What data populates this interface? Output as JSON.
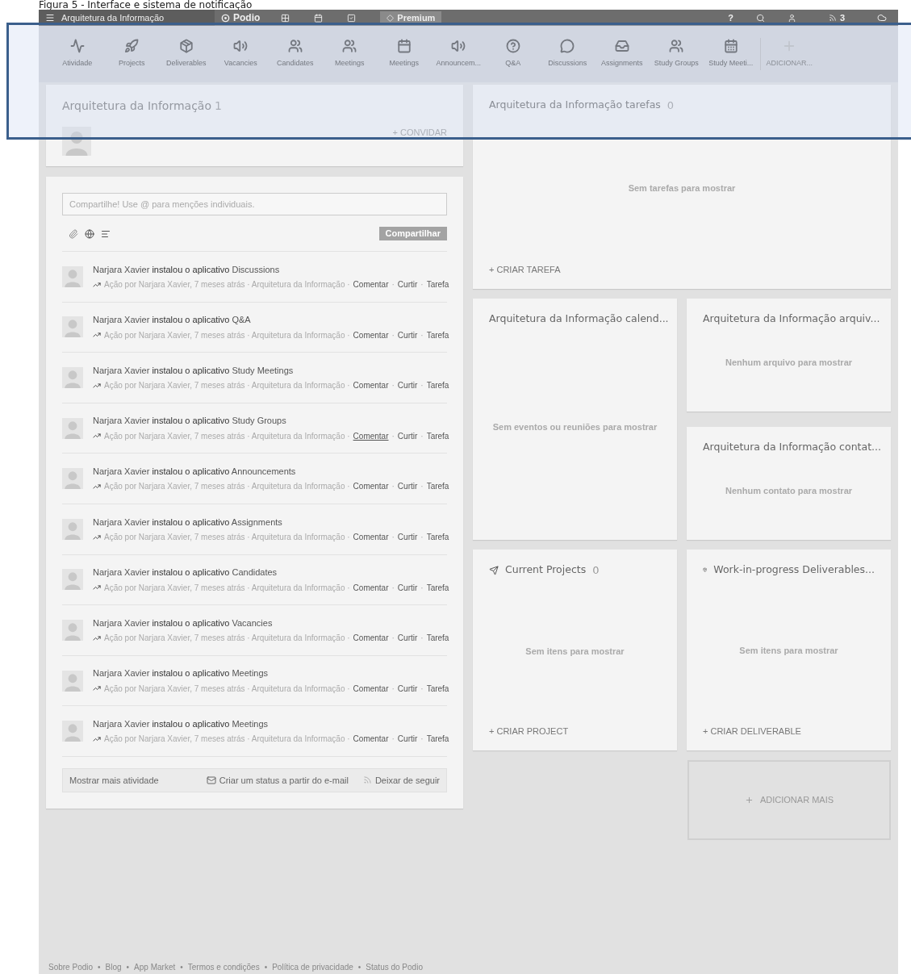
{
  "caption": "Figura 5 - Interface e sistema de notificação",
  "topbar": {
    "workspace": "Arquitetura da Informação",
    "logo": "Podio",
    "premium": "Premium",
    "help": "?",
    "notifications": "3"
  },
  "apps": [
    {
      "label": "Atividade",
      "kind": "app"
    },
    {
      "label": "Projects",
      "kind": "app"
    },
    {
      "label": "Deliverables",
      "kind": "app"
    },
    {
      "label": "Vacancies",
      "kind": "app"
    },
    {
      "label": "Candidates",
      "kind": "app"
    },
    {
      "label": "Meetings",
      "kind": "app"
    },
    {
      "label": "Meetings",
      "kind": "app"
    },
    {
      "label": "Announcem...",
      "kind": "app"
    },
    {
      "label": "Q&A",
      "kind": "app"
    },
    {
      "label": "Discussions",
      "kind": "app"
    },
    {
      "label": "Assignments",
      "kind": "app"
    },
    {
      "label": "Study Groups",
      "kind": "app"
    },
    {
      "label": "Study Meeti...",
      "kind": "app"
    },
    {
      "label": "ADICIONAR...",
      "kind": "add"
    }
  ],
  "members": {
    "title": "Arquitetura da Informação",
    "count": "1",
    "invite": "+ CONVIDAR"
  },
  "share": {
    "placeholder": "Compartilhe! Use @ para menções individuais.",
    "button": "Compartilhar"
  },
  "activity": [
    {
      "actor": "Narjara Xavier",
      "verb": "instalou o aplicativo",
      "app": "Discussions",
      "meta": "Ação por Narjara Xavier, 7 meses atrás · Arquitetura da Informação ·",
      "actions": [
        {
          "label": "Comentar",
          "hovered": false
        },
        {
          "separator": "·",
          "label": "Curtir",
          "hovered": false
        },
        {
          "separator": "·",
          "label": "Tarefa",
          "hovered": false
        }
      ]
    },
    {
      "actor": "Narjara Xavier",
      "verb": "instalou o aplicativo",
      "app": "Q&A",
      "meta": "Ação por Narjara Xavier, 7 meses atrás · Arquitetura da Informação ·",
      "actions": [
        {
          "label": "Comentar",
          "hovered": false
        },
        {
          "separator": "·",
          "label": "Curtir",
          "hovered": false
        },
        {
          "separator": "·",
          "label": "Tarefa",
          "hovered": false
        }
      ]
    },
    {
      "actor": "Narjara Xavier",
      "verb": "instalou o aplicativo",
      "app": "Study Meetings",
      "meta": "Ação por Narjara Xavier, 7 meses atrás · Arquitetura da Informação ·",
      "actions": [
        {
          "label": "Comentar",
          "hovered": false
        },
        {
          "separator": "·",
          "label": "Curtir",
          "hovered": false
        },
        {
          "separator": "·",
          "label": "Tarefa",
          "hovered": false
        }
      ]
    },
    {
      "actor": "Narjara Xavier",
      "verb": "instalou o aplicativo",
      "app": "Study Groups",
      "meta": "Ação por Narjara Xavier, 7 meses atrás · Arquitetura da Informação ·",
      "actions": [
        {
          "label": "Comentar",
          "hovered": true
        },
        {
          "separator": "·",
          "label": "Curtir",
          "hovered": false
        },
        {
          "separator": "·",
          "label": "Tarefa",
          "hovered": false
        }
      ]
    },
    {
      "actor": "Narjara Xavier",
      "verb": "instalou o aplicativo",
      "app": "Announcements",
      "meta": "Ação por Narjara Xavier, 7 meses atrás · Arquitetura da Informação ·",
      "actions": [
        {
          "label": "Comentar",
          "hovered": false
        },
        {
          "separator": "·",
          "label": "Curtir",
          "hovered": false
        },
        {
          "separator": "·",
          "label": "Tarefa",
          "hovered": false
        }
      ]
    },
    {
      "actor": "Narjara Xavier",
      "verb": "instalou o aplicativo",
      "app": "Assignments",
      "meta": "Ação por Narjara Xavier, 7 meses atrás · Arquitetura da Informação ·",
      "actions": [
        {
          "label": "Comentar",
          "hovered": false
        },
        {
          "separator": "·",
          "label": "Curtir",
          "hovered": false
        },
        {
          "separator": "·",
          "label": "Tarefa",
          "hovered": false
        }
      ]
    },
    {
      "actor": "Narjara Xavier",
      "verb": "instalou o aplicativo",
      "app": "Candidates",
      "meta": "Ação por Narjara Xavier, 7 meses atrás · Arquitetura da Informação ·",
      "actions": [
        {
          "label": "Comentar",
          "hovered": false
        },
        {
          "separator": "·",
          "label": "Curtir",
          "hovered": false
        },
        {
          "separator": "·",
          "label": "Tarefa",
          "hovered": false
        }
      ]
    },
    {
      "actor": "Narjara Xavier",
      "verb": "instalou o aplicativo",
      "app": "Vacancies",
      "meta": "Ação por Narjara Xavier, 7 meses atrás · Arquitetura da Informação ·",
      "actions": [
        {
          "label": "Comentar",
          "hovered": false
        },
        {
          "separator": "·",
          "label": "Curtir",
          "hovered": false
        },
        {
          "separator": "·",
          "label": "Tarefa",
          "hovered": false
        }
      ]
    },
    {
      "actor": "Narjara Xavier",
      "verb": "instalou o aplicativo",
      "app": "Meetings",
      "meta": "Ação por Narjara Xavier, 7 meses atrás · Arquitetura da Informação ·",
      "actions": [
        {
          "label": "Comentar",
          "hovered": false
        },
        {
          "separator": "·",
          "label": "Curtir",
          "hovered": false
        },
        {
          "separator": "·",
          "label": "Tarefa",
          "hovered": false
        }
      ]
    },
    {
      "actor": "Narjara Xavier",
      "verb": "instalou o aplicativo",
      "app": "Meetings",
      "meta": "Ação por Narjara Xavier, 7 meses atrás · Arquitetura da Informação ·",
      "actions": [
        {
          "label": "Comentar",
          "hovered": false
        },
        {
          "separator": "·",
          "label": "Curtir",
          "hovered": false
        },
        {
          "separator": "·",
          "label": "Tarefa",
          "hovered": false
        }
      ]
    }
  ],
  "activity_footer": {
    "show_more": "Mostrar mais atividade",
    "email_status": "Criar um status a partir do e-mail",
    "unfollow": "Deixar de seguir"
  },
  "tasks": {
    "title": "Arquitetura da Informação tarefas",
    "count": "0",
    "empty": "Sem tarefas para mostrar",
    "create": "+ CRIAR TAREFA"
  },
  "calendar": {
    "title": "Arquitetura da Informação calend...",
    "empty": "Sem eventos ou reuniões para mostrar"
  },
  "files": {
    "title": "Arquitetura da Informação arquiv...",
    "empty": "Nenhum arquivo para mostrar"
  },
  "contacts": {
    "title": "Arquitetura da Informação contat...",
    "empty": "Nenhum contato para mostrar"
  },
  "projects": {
    "title": "Current Projects",
    "count": "0",
    "empty": "Sem itens para mostrar",
    "create": "+ CRIAR PROJECT"
  },
  "deliverables": {
    "title": "Work-in-progress Deliverables...",
    "empty": "Sem itens para mostrar",
    "create": "+ CRIAR DELIVERABLE"
  },
  "add_more": "ADICIONAR MAIS",
  "footer_links": [
    {
      "label": "Sobre Podio"
    },
    {
      "separator": "•",
      "label": "Blog"
    },
    {
      "separator": "•",
      "label": "App Market"
    },
    {
      "separator": "•",
      "label": "Termos e condições"
    },
    {
      "separator": "•",
      "label": "Política de privacidade"
    },
    {
      "separator": "•",
      "label": "Status do Podio"
    }
  ]
}
